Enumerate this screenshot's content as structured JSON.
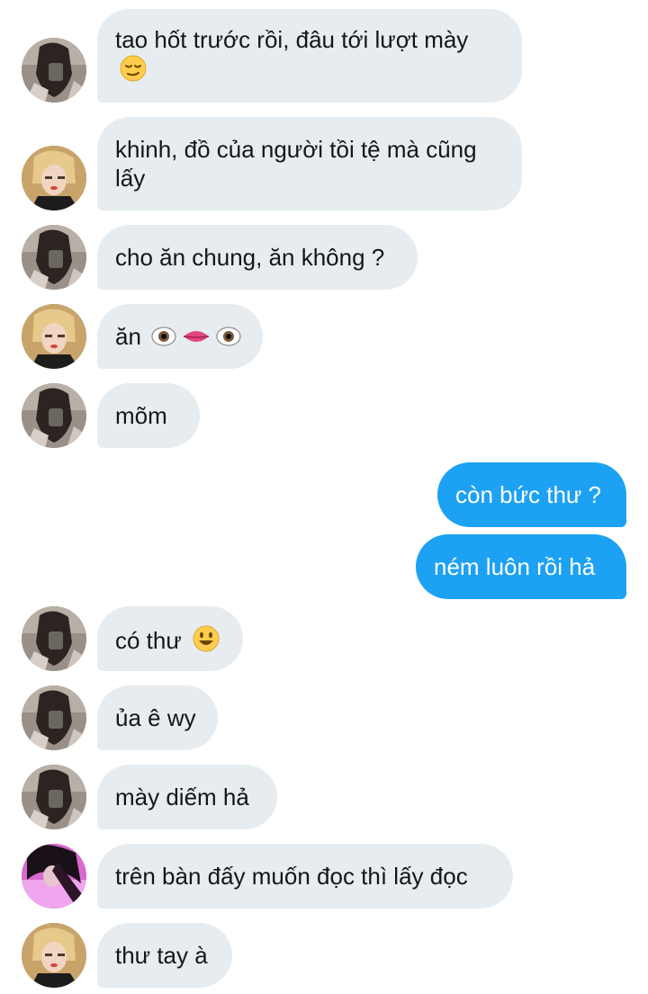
{
  "colors": {
    "incoming_bubble": "#e6ecf0",
    "outgoing_bubble": "#1da1f2",
    "incoming_text": "#14171a",
    "outgoing_text": "#ffffff"
  },
  "messages": [
    {
      "sender": "friend-a",
      "text": "tao hốt trước rồi, đâu tới lượt mày",
      "emoji": "relieved-face-icon"
    },
    {
      "sender": "friend-b",
      "text": "khinh, đồ của người tồi tệ mà cũng lấy"
    },
    {
      "sender": "friend-a",
      "text": "cho ăn chung, ăn không ?"
    },
    {
      "sender": "friend-b",
      "text": "ăn",
      "emoji": "eyes-lips-eyes-icon"
    },
    {
      "sender": "friend-a",
      "text": "mõm"
    },
    {
      "sender": "me",
      "text": "còn bức thư ?"
    },
    {
      "sender": "me",
      "text": "ném luôn rồi hả"
    },
    {
      "sender": "friend-a",
      "text": "có thư",
      "emoji": "smiling-face-icon"
    },
    {
      "sender": "friend-a",
      "text": "ủa ê wy"
    },
    {
      "sender": "friend-a",
      "text": "mày diếm hả"
    },
    {
      "sender": "friend-c",
      "text": "trên bàn đấy muốn đọc thì lấy đọc"
    },
    {
      "sender": "friend-b",
      "text": "thư tay à"
    }
  ]
}
